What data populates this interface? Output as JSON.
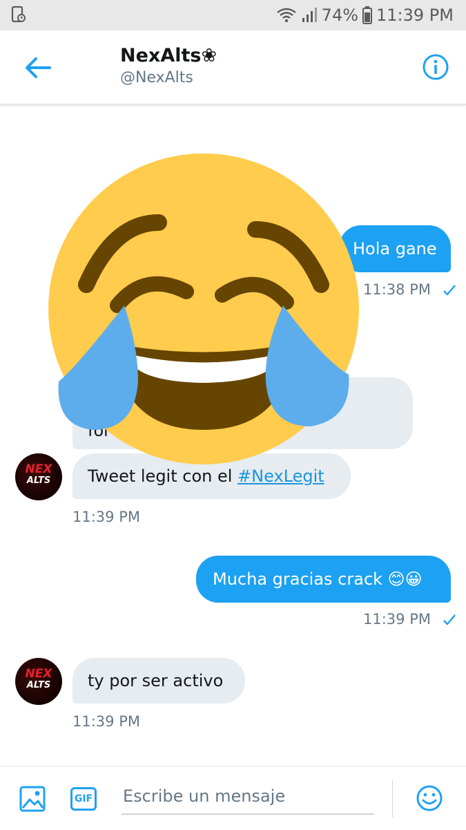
{
  "status_bar": {
    "battery": "74%",
    "time": "11:39 PM"
  },
  "header": {
    "name": "NexAlts❀",
    "handle": "@NexAlts"
  },
  "messages": [
    {
      "text": "Hola gane",
      "time": "11:38 PM"
    },
    {
      "text": "for",
      "partial": true
    },
    {
      "text_before": "Tweet legit con el ",
      "hashtag": "#NexLegit",
      "time": "11:39 PM"
    },
    {
      "text": "Mucha gracias crack 😊😀",
      "time": "11:39 PM"
    },
    {
      "text": "ty por ser activo",
      "time": "11:39 PM"
    }
  ],
  "avatar": {
    "line1": "NEX",
    "line2": "ALTS"
  },
  "composer": {
    "gif_label": "GIF",
    "placeholder": "Escribe un mensaje"
  },
  "icons": {
    "back": "arrow-left-icon",
    "info": "info-icon",
    "image": "image-icon",
    "emoji": "smiley-icon",
    "overlay": "face-with-tears-of-joy-emoji"
  },
  "colors": {
    "accent": "#1da1f2",
    "bubble_in": "#e6ecf0",
    "muted": "#657786"
  }
}
